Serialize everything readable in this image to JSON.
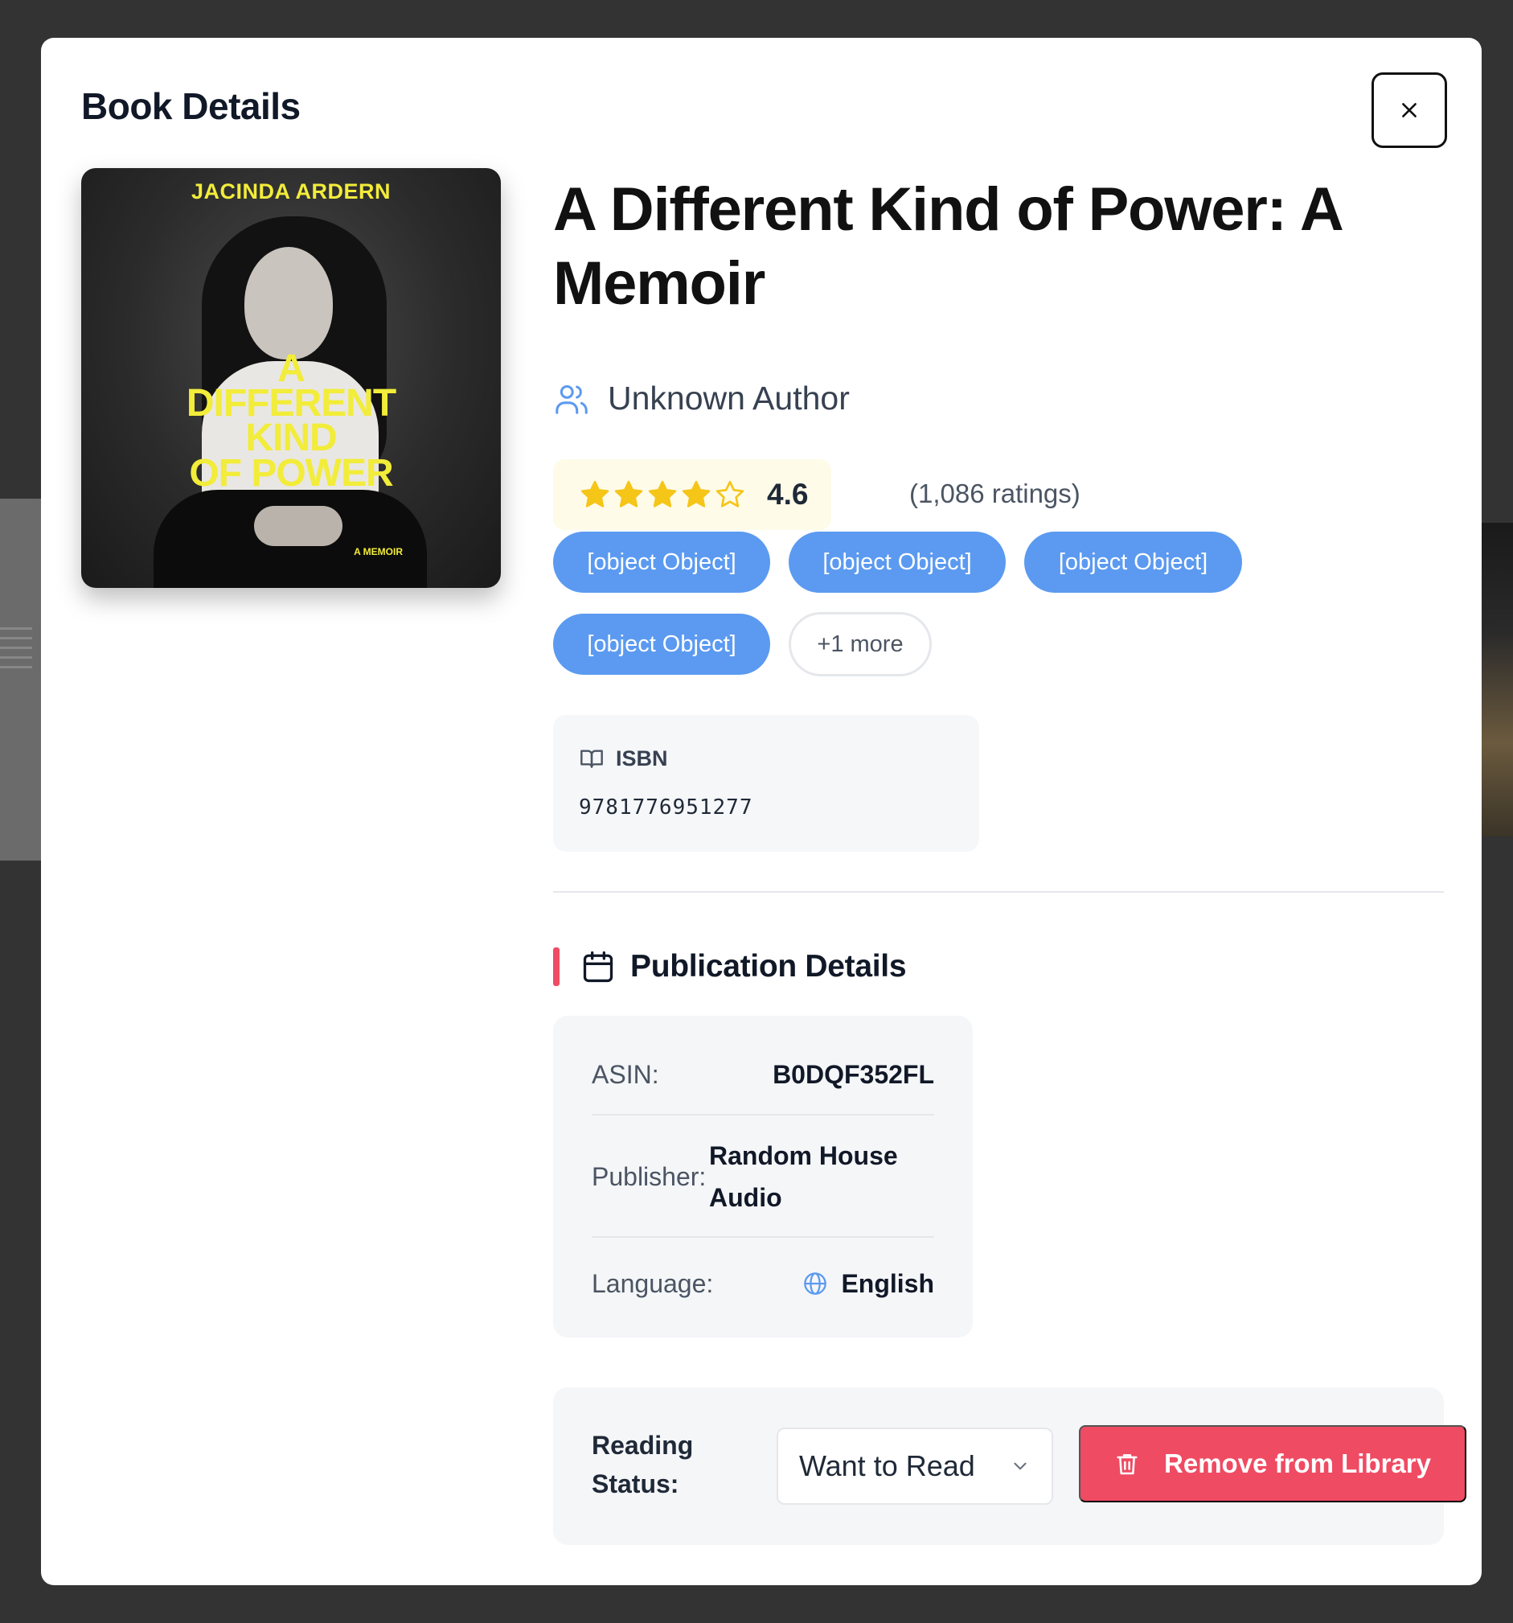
{
  "modal": {
    "title": "Book Details",
    "close_glyph": "×",
    "corner_glyph": "×"
  },
  "cover": {
    "author": "JACINDA ARDERN",
    "title_lines": [
      "A",
      "DIFFERENT",
      "KIND",
      "OF POWER"
    ],
    "subtitle": "A MEMOIR"
  },
  "book": {
    "title": "A Different Kind of Power: A Memoir",
    "author": "Unknown Author",
    "author_icon": "users-icon"
  },
  "rating": {
    "stars_filled": 4,
    "stars_total": 5,
    "value": "4.6",
    "count_text": "(1,086 ratings)",
    "star_color": "#f5c518"
  },
  "tags": {
    "items": [
      "[object Object]",
      "[object Object]",
      "[object Object]",
      "[object Object]"
    ],
    "more_label": "+1 more",
    "color": "#5b9af0"
  },
  "isbn": {
    "label": "ISBN",
    "value": "9781776951277",
    "icon": "book-open-icon"
  },
  "publication": {
    "heading": "Publication Details",
    "icon": "calendar-icon",
    "accent": "#ef4b63",
    "asin_label": "ASIN:",
    "asin_value": "B0DQF352FL",
    "publisher_label": "Publisher:",
    "publisher_value_line1": "Random House",
    "publisher_value_line2": "Audio",
    "language_label": "Language:",
    "language_value": "English",
    "language_icon": "globe-icon"
  },
  "reading": {
    "label_line1": "Reading",
    "label_line2": "Status:",
    "selected": "Want to Read",
    "remove_label": "Remove from Library",
    "remove_color": "#ef4b63"
  }
}
